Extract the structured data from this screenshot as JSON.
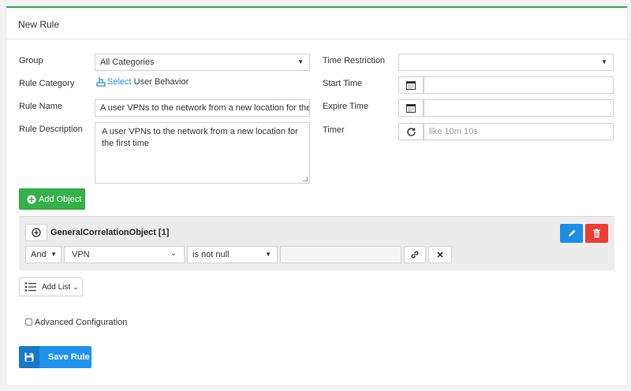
{
  "panel": {
    "title": "New Rule"
  },
  "form": {
    "group_label": "Group",
    "group_value": "All Categories",
    "rule_category_label": "Rule Category",
    "rule_category_link": "Select",
    "rule_category_value": "User Behavior",
    "rule_name_label": "Rule Name",
    "rule_name_value": "A user VPNs to the network from a new location for the f",
    "rule_description_label": "Rule Description",
    "rule_description_value": "A user VPNs to the network from a new location for the first time",
    "time_restriction_label": "Time Restriction",
    "time_restriction_value": "",
    "start_time_label": "Start Time",
    "start_time_value": "",
    "expire_time_label": "Expire Time",
    "expire_time_value": "",
    "timer_label": "Timer",
    "timer_placeholder": "like 10m 10s"
  },
  "add_object_label": "Add Object",
  "object": {
    "title": "GeneralCorrelationObject [1]",
    "logic_value": "And",
    "field_value": "VPN",
    "operator_value": "is not null",
    "value_input": ""
  },
  "add_list_label": "Add List",
  "advanced_config_label": "Advanced Configuration",
  "save_label": "Save Rule",
  "colors": {
    "accent_green": "#36b04a",
    "primary_blue": "#1e92ec",
    "danger_red": "#ee3b34"
  },
  "icons": {
    "add_object": "plus-circle-icon",
    "calendar": "calendar-icon",
    "timer": "refresh-icon",
    "edit": "pencil-icon",
    "delete": "trash-icon",
    "link": "link-icon",
    "remove": "close-icon",
    "list": "list-icon",
    "save": "floppy-disk-icon",
    "category": "hand-pointer-icon"
  }
}
